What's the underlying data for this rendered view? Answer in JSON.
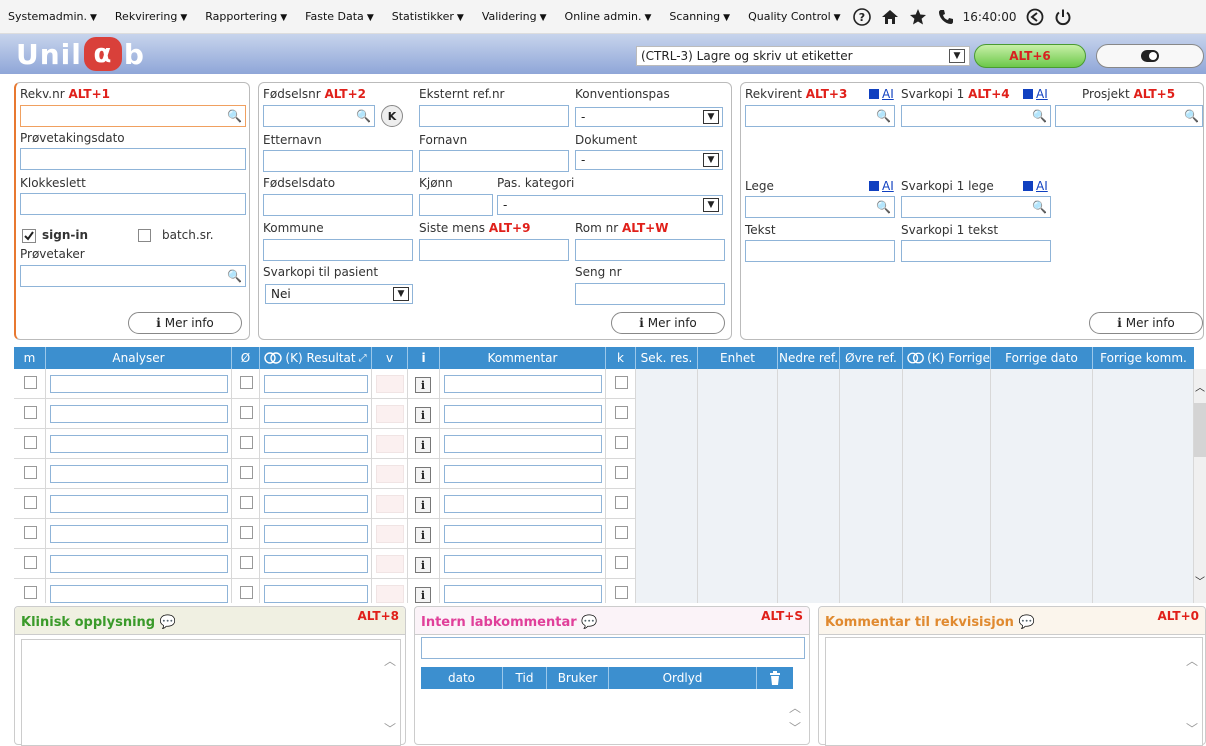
{
  "menubar": {
    "items": [
      "Systemadmin.",
      "Rekvirering",
      "Rapportering",
      "Faste Data",
      "Statistikker",
      "Validering",
      "Online admin.",
      "Scanning",
      "Quality Control"
    ],
    "clock": "16:40:00"
  },
  "banner": {
    "logo_left": "Unil",
    "logo_alpha": "α",
    "logo_right": "b",
    "print_select": "(CTRL-3) Lagre og skriv ut etiketter",
    "green_button": "ALT+6"
  },
  "left_panel": {
    "rekv_label": "Rekv.nr",
    "rekv_alt": "ALT+1",
    "provedato_label": "Prøvetakingsdato",
    "klokke_label": "Klokkeslett",
    "signin_label": "sign-in",
    "signin_checked": true,
    "batch_label": "batch.sr.",
    "batch_checked": false,
    "provetaker_label": "Prøvetaker",
    "mer_info": "Mer info"
  },
  "mid_panel": {
    "fodselsnr_label": "Fødselsnr",
    "fodselsnr_alt": "ALT+2",
    "k_button": "K",
    "ekstern_label": "Eksternt ref.nr",
    "konvention_label": "Konventionspas",
    "konvention_value": "-",
    "etternavn_label": "Etternavn",
    "fornavn_label": "Fornavn",
    "dokument_label": "Dokument",
    "dokument_value": "-",
    "fodselsdato_label": "Fødselsdato",
    "kjonn_label": "Kjønn",
    "pas_kategori_label": "Pas. kategori",
    "pas_kategori_value": "-",
    "kommune_label": "Kommune",
    "siste_mens_label": "Siste mens",
    "siste_mens_alt": "ALT+9",
    "rom_label": "Rom nr",
    "rom_alt": "ALT+W",
    "svarkopi_pas_label": "Svarkopi til pasient",
    "svarkopi_pas_value": "Nei",
    "seng_label": "Seng nr",
    "mer_info": "Mer info"
  },
  "right_panel": {
    "rekvirent_label": "Rekvirent",
    "rekvirent_alt": "ALT+3",
    "ai_label": "AI",
    "svarkopi1_label": "Svarkopi 1",
    "svarkopi1_alt": "ALT+4",
    "prosjekt_label": "Prosjekt",
    "prosjekt_alt": "ALT+5",
    "lege_label": "Lege",
    "svarkopi1_lege_label": "Svarkopi 1 lege",
    "tekst_label": "Tekst",
    "svarkopi1_tekst_label": "Svarkopi 1 tekst",
    "mer_info": "Mer info"
  },
  "grid": {
    "headers": [
      "m",
      "Analyser",
      "Ø",
      "(K) Resultat",
      "v",
      "i",
      "Kommentar",
      "k",
      "Sek. res.",
      "Enhet",
      "Nedre ref.",
      "Øvre ref.",
      "(K) Forrige",
      "Forrige dato",
      "Forrige komm."
    ],
    "row_count": 8
  },
  "bottom": {
    "klinisk_title": "Klinisk opplysning",
    "klinisk_alt": "ALT+8",
    "klinisk_color": "#3a9a2a",
    "intern_title": "Intern labkommentar",
    "intern_alt": "ALT+S",
    "intern_color": "#e0409a",
    "intern_headers": [
      "dato",
      "Tid",
      "Bruker",
      "Ordlyd"
    ],
    "kommentar_title": "Kommentar til rekvisisjon",
    "kommentar_alt": "ALT+0",
    "kommentar_color": "#e08a30"
  },
  "colors": {
    "accent": "#3c8fcf",
    "alt_red": "#e0201a",
    "input_border": "#8fb4d8"
  }
}
